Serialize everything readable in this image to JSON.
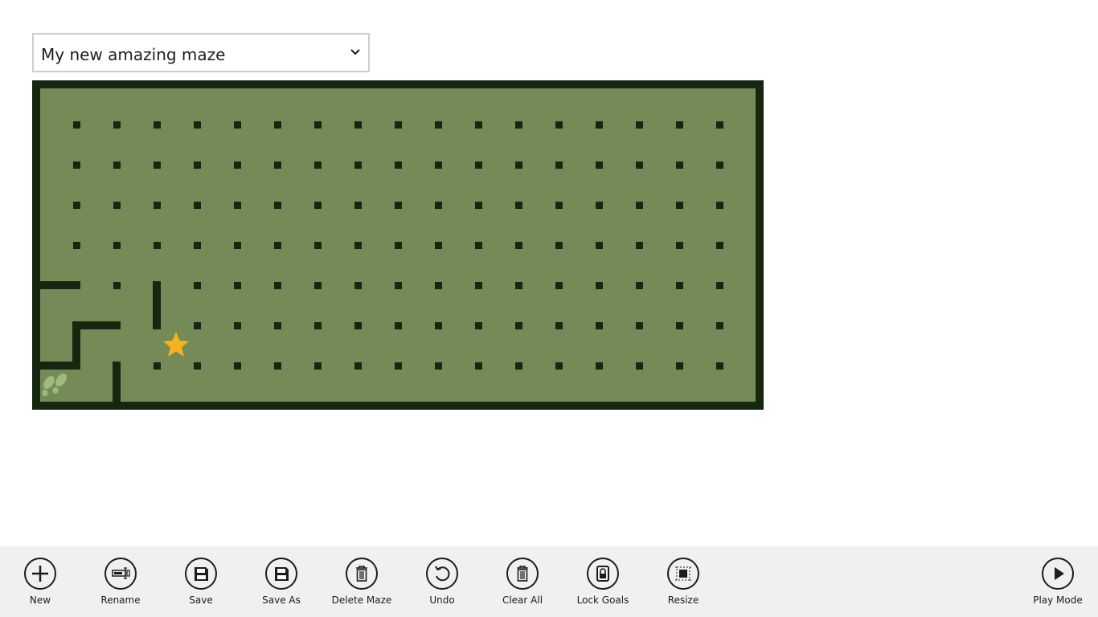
{
  "maze_selector": {
    "selected": "My new amazing maze"
  },
  "maze": {
    "colors": {
      "floor": "#748b57",
      "wall": "#152711",
      "goal_star": "#f8b21d",
      "start_footprints": "#9dbb7c"
    },
    "walls": [
      "left-edge-row-5",
      "row-5-col-1-segment",
      "col-3-vertical-rows-5-6",
      "row-6-cols-1-2",
      "col-1-vertical-rows-6-7",
      "row-7-col-0",
      "col-2-vertical-rows-7-8"
    ],
    "goal_icon": "star-icon",
    "start_icon": "footprints-icon"
  },
  "app_bar": {
    "commands": [
      {
        "label": "New",
        "icon": "plus-icon"
      },
      {
        "label": "Rename",
        "icon": "rename-icon"
      },
      {
        "label": "Save",
        "icon": "save-icon"
      },
      {
        "label": "Save As",
        "icon": "save-as-icon"
      },
      {
        "label": "Delete Maze",
        "icon": "trash-icon"
      },
      {
        "label": "Undo",
        "icon": "undo-icon"
      },
      {
        "label": "Clear All",
        "icon": "trash-icon"
      },
      {
        "label": "Lock Goals",
        "icon": "lock-icon"
      },
      {
        "label": "Resize",
        "icon": "resize-icon"
      }
    ],
    "play_mode": {
      "label": "Play Mode",
      "icon": "play-icon"
    }
  }
}
